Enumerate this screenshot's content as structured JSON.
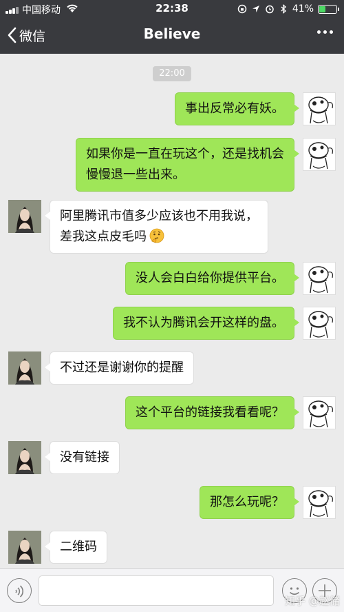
{
  "status_bar": {
    "carrier": "中国移动",
    "time": "22:38",
    "battery": "41%",
    "battery_level": 0.41
  },
  "nav": {
    "back_label": "微信",
    "title": "Believe"
  },
  "chat": {
    "time_divider": "22:00",
    "messages": [
      {
        "side": "right",
        "lines": [
          "事出反常必有妖。"
        ]
      },
      {
        "side": "right",
        "lines": [
          "如果你是一直在玩这个，还是找机会",
          "慢慢退一些出来。"
        ]
      },
      {
        "side": "left",
        "lines": [
          "阿里腾讯市值多少应该也不用我说，",
          "差我这点皮毛吗"
        ],
        "emoji": "thinking-face"
      },
      {
        "side": "right",
        "lines": [
          "没人会白白给你提供平台。"
        ]
      },
      {
        "side": "right",
        "lines": [
          "我不认为腾讯会开这样的盘。"
        ]
      },
      {
        "side": "left",
        "lines": [
          "不过还是谢谢你的提醒"
        ]
      },
      {
        "side": "right",
        "lines": [
          "这个平台的链接我看看呢？"
        ]
      },
      {
        "side": "left",
        "lines": [
          "没有链接"
        ]
      },
      {
        "side": "right",
        "lines": [
          "那怎么玩呢？"
        ]
      },
      {
        "side": "left",
        "lines": [
          "二维码"
        ]
      }
    ]
  },
  "watermark": "知乎 @赵储",
  "colors": {
    "nav_bg": "#393a3e",
    "chat_bg": "#ebebeb",
    "my_bubble": "#9fe658",
    "their_bubble": "#ffffff"
  }
}
